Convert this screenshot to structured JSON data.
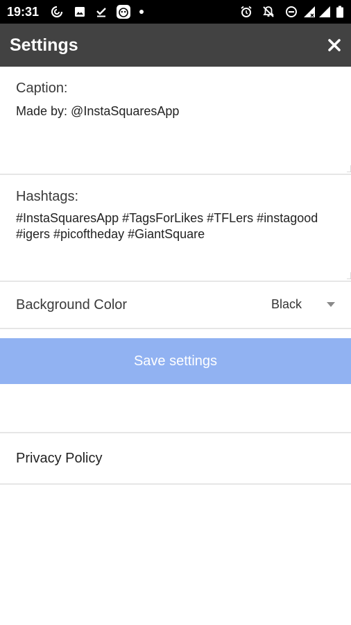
{
  "status_bar": {
    "time": "19:31",
    "icons": [
      "sync-icon",
      "image-icon",
      "check-download-icon",
      "robot-icon",
      "dot-icon",
      "alarm-icon",
      "notifications-off-icon",
      "do-not-disturb-icon",
      "signal-icon",
      "signal-full-icon",
      "battery-icon"
    ]
  },
  "app_bar": {
    "title": "Settings",
    "close_icon": "close-icon"
  },
  "caption": {
    "label": "Caption:",
    "value": "Made by: @InstaSquaresApp"
  },
  "hashtags": {
    "label": "Hashtags:",
    "value": "#InstaSquaresApp #TagsForLikes #TFLers #instagood #igers #picoftheday #GiantSquare"
  },
  "background_color": {
    "label": "Background Color",
    "selected": "Black"
  },
  "save": {
    "label": "Save settings",
    "color": "#91b2f2"
  },
  "privacy": {
    "label": "Privacy Policy"
  },
  "colors": {
    "status_bar": "#000000",
    "app_bar": "#424242",
    "divider": "#e6e6e6"
  }
}
